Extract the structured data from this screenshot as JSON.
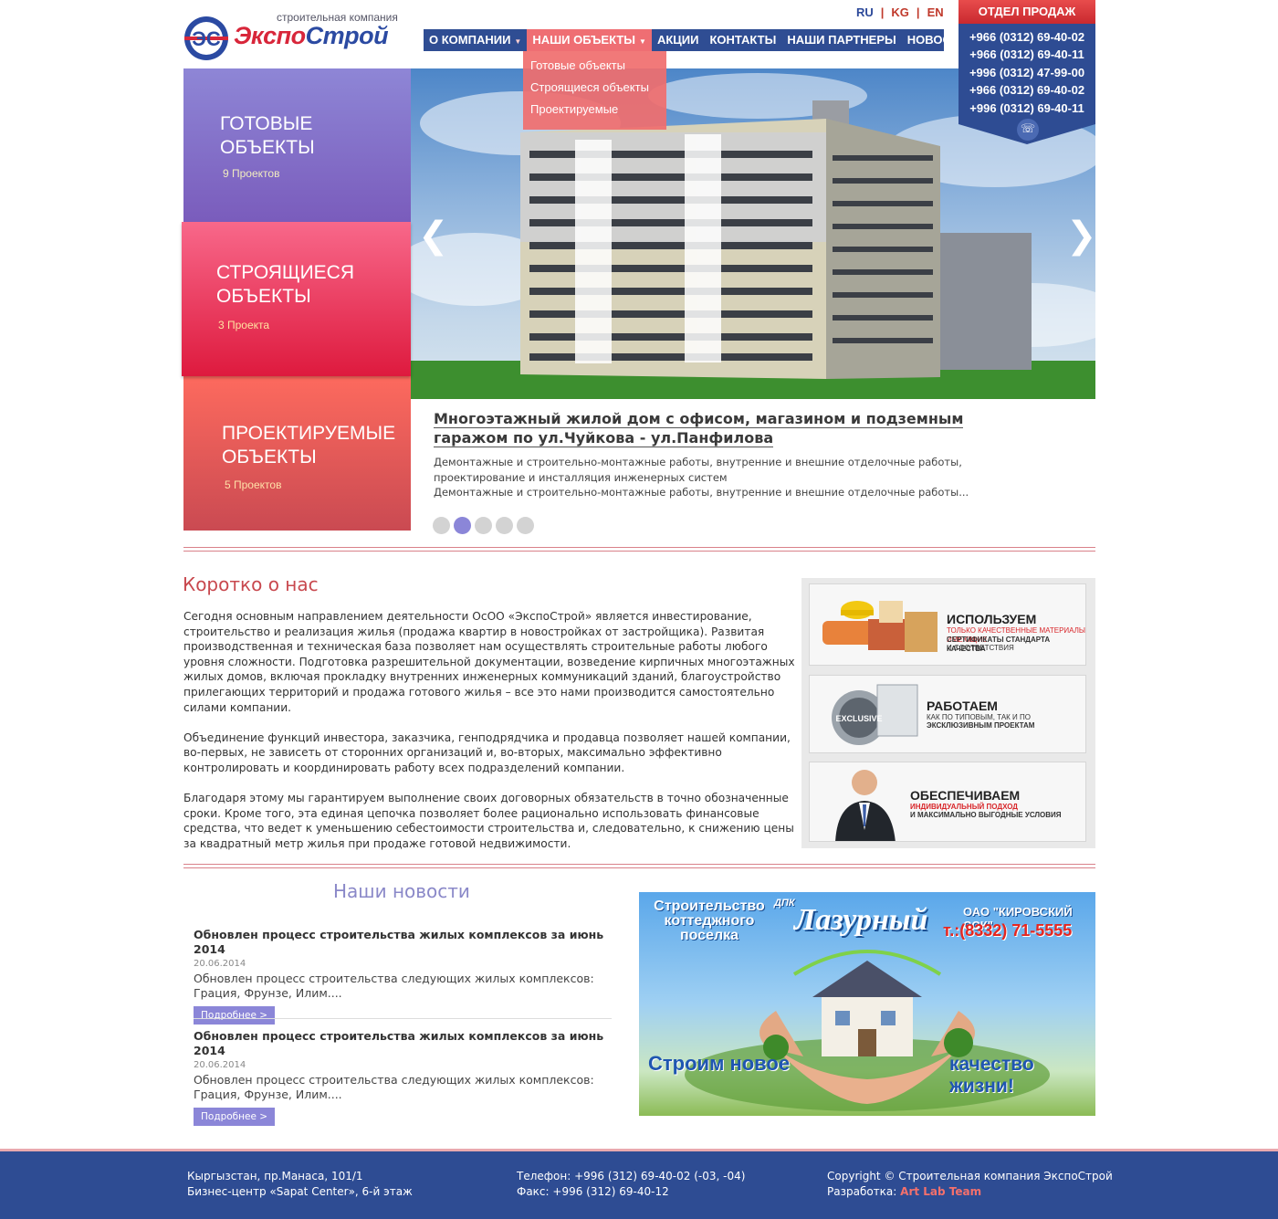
{
  "header": {
    "logo_subtitle": "строительная компания",
    "logo_part1": "Экспо",
    "logo_part2": "Строй",
    "languages": [
      "RU",
      "KG",
      "EN"
    ],
    "lang_separator": "|"
  },
  "nav": {
    "items": [
      {
        "label": "О КОМПАНИИ"
      },
      {
        "label": "НАШИ ОБЪЕКТЫ"
      },
      {
        "label": "АКЦИИ"
      },
      {
        "label": "КОНТАКТЫ"
      },
      {
        "label": "НАШИ ПАРТНЕРЫ"
      },
      {
        "label": "НОВОСТИ"
      }
    ],
    "caret": "▼",
    "dropdown": [
      "Готовые объекты",
      "Строящиеся объекты",
      "Проектируемые"
    ]
  },
  "sales": {
    "title": "ОТДЕЛ ПРОДАЖ",
    "phones": [
      "+966 (0312) 69-40-02",
      "+966 (0312) 69-40-11",
      "+996 (0312) 47-99-00",
      "+966 (0312) 69-40-02",
      "+996 (0312) 69-40-11"
    ],
    "phone_icon": "☏"
  },
  "categories": [
    {
      "title": "Готовые объекты",
      "count": "9 Проектов"
    },
    {
      "title": "Строящиеся объекты",
      "count": "3 Проекта"
    },
    {
      "title": "Проектируемые объекты",
      "count": "5 Проектов"
    }
  ],
  "slider": {
    "prev": "❮",
    "next": "❯",
    "title": "Многоэтажный жилой дом с офисом, магазином и подземным гаражом по ул.Чуйкова - ул.Панфилова",
    "desc1": "Демонтажные и строительно-монтажные работы, внутренние и внешние отделочные работы, проектирование и инсталляция инженерных систем",
    "desc2": "Демонтажные и строительно-монтажные работы, внутренние и внешние отделочные работы...",
    "active_dot": 2
  },
  "about": {
    "heading": "Коротко о нас",
    "p1": "Сегодня основным направлением деятельности ОсОО «ЭкспоСтрой» является инвестирование, строительство и реализация жилья (продажа квартир в новостройках от застройщика). Развитая производственная и техническая база позволяет нам осуществлять строительные работы любого уровня сложности. Подготовка разрешительной документации, возведение кирпичных многоэтажных жилых домов, включая прокладку внутренних инженерных коммуникаций зданий, благоустройство прилегающих территорий и продажа готового жилья – все это нами производится самостоятельно силами компании.",
    "p2": "Объединение функций инвестора, заказчика, генподрядчика и продавца позволяет нашей компании, во-первых, не зависеть от сторонних организаций и, во-вторых, максимально эффективно контролировать и координировать работу всех подразделений компании.",
    "p3": "Благодаря этому мы гарантируем выполнение своих договорных обязательств в точно обозначенные сроки. Кроме того, эта единая цепочка позволяет более рационально использовать финансовые средства, что ведет к уменьшению себестоимости строительства и, следовательно, к снижению цены за квадратный метр жилья при продаже готовой недвижимости."
  },
  "banners": [
    {
      "title": "ИСПОЛЬЗУЕМ",
      "line1": "ТОЛЬКО КАЧЕСТВЕННЫЕ МАТЕРИАЛЫ ИМЕЮЩИЕ",
      "line2": "СЕРТИФИКАТЫ СТАНДАРТА КАЧЕСТВА",
      "line3": "И СООТВЕТСТВИЯ"
    },
    {
      "title": "РАБОТАЕМ",
      "line1": "КАК ПО ТИПОВЫМ, ТАК И ПО",
      "line2": "ЭКСКЛЮЗИВНЫМ ПРОЕКТАМ",
      "badge": "EXCLUSIVE"
    },
    {
      "title": "ОБЕСПЕЧИВАЕМ",
      "line1": "ИНДИВИДУАЛЬНЫЙ ПОДХОД",
      "line2": "И МАКСИМАЛЬНО ВЫГОДНЫЕ УСЛОВИЯ"
    }
  ],
  "news": {
    "heading": "Наши новости",
    "items": [
      {
        "title": "Обновлен процесс строительства жилых комплексов за июнь 2014",
        "date": "20.06.2014",
        "text": "Обновлен процесс строительства следующих жилых комплексов: Грация, Фрунзе, Илим....",
        "more": "Подробнее >"
      },
      {
        "title": "Обновлен процесс строительства жилых комплексов за июнь 2014",
        "date": "20.06.2014",
        "text": "Обновлен процесс строительства следующих жилых комплексов: Грация, Фрунзе, Илим....",
        "more": "Подробнее >"
      }
    ]
  },
  "promo": {
    "line1": "Строительство коттеджного поселка",
    "brand_prefix": "ДПК",
    "brand": "Лазурный",
    "company": "ОАО \"КИРОВСКИЙ ССК\"",
    "phone": "т.:(8332) 71-5555",
    "slogan1": "Строим новое",
    "slogan2": "качество жизни!"
  },
  "footer": {
    "address1": "Кыргызстан, пр.Манаса, 101/1",
    "address2": "Бизнес-центр «Sapat Center», 6-й этаж",
    "phone": "Телефон: +996 (312) 69-40-02 (-03, -04)",
    "fax": "Факс: +996 (312) 69-40-12",
    "copyright": "Copyright © Строительная компания ЭкспоСтрой",
    "dev_label": "Разработка:",
    "dev_link": "Art Lab Team"
  }
}
